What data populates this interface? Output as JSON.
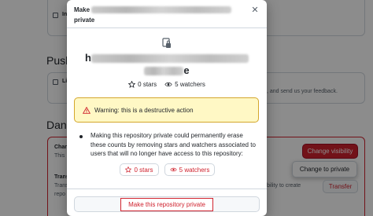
{
  "background": {
    "section_push": "Push",
    "section_danger": "Dang",
    "check1_label": "In",
    "check2_label": "Li",
    "feedback_tail": ", and send us your feedback.",
    "row_change_head": "Chan",
    "row_change_sub": "This",
    "row_transfer_head": "Trans",
    "row_transfer_sub": "Trans",
    "row_transfer_tail": "bility to create",
    "row_transfer_sub2": "repo",
    "change_visibility_button": "Change visibility",
    "change_to_private_item": "Change to private",
    "transfer_button": "Transfer"
  },
  "dialog": {
    "title_prefix": "Make",
    "title_suffix": "private",
    "close_icon": "x-icon",
    "repo_name_first": "h",
    "repo_name_last": "e",
    "stars": "0 stars",
    "watchers": "5 watchers",
    "warning": "Warning: this is a destructive action",
    "body": "Making this repository private could permanently erase these counts by removing stars and watchers associated to users that will no longer have access to this repository:",
    "stars_pill": "0 stars",
    "watchers_pill": "5 watchers",
    "confirm_button": "Make this repository private"
  },
  "colors": {
    "danger": "#cf222e",
    "warning_bg": "#fff8c5",
    "warning_border": "#d4a72c"
  }
}
